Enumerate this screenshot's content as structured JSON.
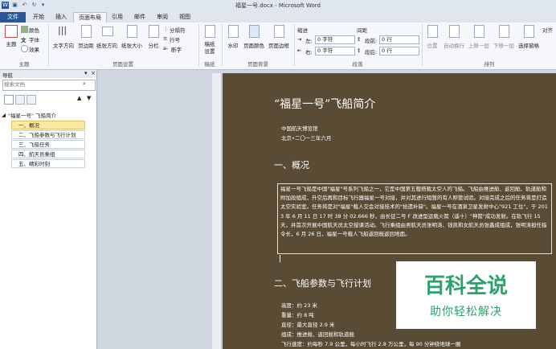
{
  "window": {
    "title": "福星一号.docx - Microsoft Word"
  },
  "tabs": [
    {
      "label": "文件"
    },
    {
      "label": "开始"
    },
    {
      "label": "插入"
    },
    {
      "label": "页面布局"
    },
    {
      "label": "引用"
    },
    {
      "label": "邮件"
    },
    {
      "label": "审阅"
    },
    {
      "label": "视图"
    }
  ],
  "ribbon": {
    "theme": {
      "label": "主题",
      "colors": "颜色",
      "fonts": "字体",
      "effects": "效果",
      "group": "主题"
    },
    "page_setup": {
      "text_direction": "文字方向",
      "margins": "页边距",
      "orientation": "纸张方向",
      "size": "纸张大小",
      "columns": "分栏",
      "breaks": "分隔符",
      "line_numbers": "行号",
      "hyphenation": "断字",
      "group": "页面设置"
    },
    "draft": {
      "label1": "稿纸",
      "label2": "设置",
      "group": "稿纸"
    },
    "page_background": {
      "watermark": "水印",
      "page_color": "页面颜色",
      "page_borders": "页面边框",
      "group": "页面背景"
    },
    "paragraph": {
      "indent_label": "缩进",
      "spacing_label": "间距",
      "left_label": "左:",
      "left_value": "0 字符",
      "right_label": "右:",
      "right_value": "0 字符",
      "before_label": "段前:",
      "before_value": "0 行",
      "after_label": "段后:",
      "after_value": "0 行",
      "group": "段落"
    },
    "arrange": {
      "position": "位置",
      "wrap": "自动换行",
      "bring_forward": "上移一层",
      "send_backward": "下移一层",
      "selection_pane": "选择窗格",
      "align": "对齐",
      "group": "排列"
    }
  },
  "nav_pane": {
    "title": "导航",
    "search_placeholder": "搜索文档",
    "items": [
      {
        "label": "\"福星一号\" 飞船简介",
        "level": 0
      },
      {
        "label": "一、概况",
        "level": 1,
        "selected": true
      },
      {
        "label": "二、飞船参数与飞行计划",
        "level": 1
      },
      {
        "label": "三、飞船任务",
        "level": 1
      },
      {
        "label": "四、航天员乘组",
        "level": 1
      },
      {
        "label": "五、精彩时刻",
        "level": 1
      }
    ]
  },
  "document": {
    "title": "“福星一号”飞船简介",
    "author_line1": "中国航天博览馆",
    "author_line2": "北京•二〇一三年六月",
    "section1": "一、概况",
    "para1": "福星一号飞船是中国\"福星\"号系列飞船之一，它是中国第五艘搭载太空人的飞船。飞船由推进舱、返回舱、轨道舱和附加段组成，升空后再和目标飞行器福星一号对接，并对其进行短暂的有人照管试验。对接完成之后的任务将是打造太空实验室。任务将是对\"福星\"载人交会对接技术的\"拾遗补缺\"。福星一号在酒泉卫星发射中心\"921 工位\"，于 2013 年 6 月 11 日 17 时 38 分 02.666 秒，由长征二号 F 改进型运载火箭（遥十）\"神箭\"成功发射。在轨飞行 15 天，并首次开展中国航天员太空授课活动。飞行乘组由男航天员张明涛、钱凯和女航天员张鑫成组成，张明涛担任指令长，6 月 26 日，福星一号载人飞船返回舱返回地面。",
    "section2": "二、飞船参数与飞行计划",
    "specs": [
      "高度：约 23 米",
      "重量：约 8 吨",
      "直径：最大直径 2.9 米",
      "组成：推进舱、返回舱和轨道舱",
      "飞行速度：约每秒 7.9 公里，每小时飞行 2.8 万公里，每 90 分钟绕地球一圈"
    ]
  },
  "watermark": {
    "big": "百科全说",
    "small": "助你轻松解决"
  }
}
